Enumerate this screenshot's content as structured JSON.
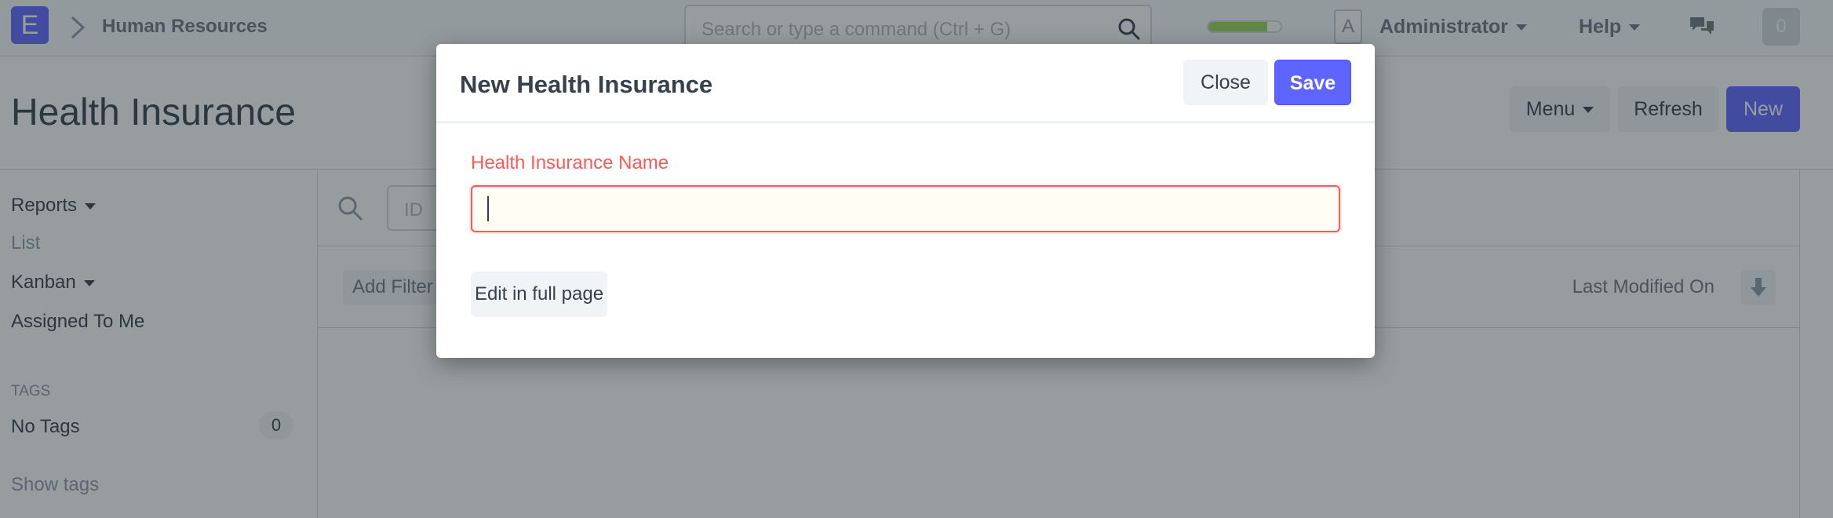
{
  "navbar": {
    "logo_letter": "E",
    "module": "Human Resources",
    "search_placeholder": "Search or type a command (Ctrl + G)",
    "progress": 0.82,
    "avatar_letter": "A",
    "user": "Administrator",
    "help": "Help",
    "notification_count": "0"
  },
  "page": {
    "title": "Health Insurance",
    "menu_label": "Menu",
    "refresh_label": "Refresh",
    "new_label": "New"
  },
  "sidebar": {
    "reports": "Reports",
    "list": "List",
    "kanban": "Kanban",
    "assigned": "Assigned To Me",
    "tags_heading": "TAGS",
    "no_tags": "No Tags",
    "tag_count": "0",
    "show_tags": "Show tags"
  },
  "list": {
    "id_placeholder": "ID",
    "add_filter": "Add Filter",
    "sort_label": "Last Modified On"
  },
  "modal": {
    "title": "New Health Insurance",
    "close_label": "Close",
    "save_label": "Save",
    "field_label": "Health Insurance Name",
    "field_value": "",
    "edit_full_label": "Edit in full page"
  },
  "colors": {
    "primary": "#5e64ff",
    "required": "#ff5858",
    "progress": "#98d85b"
  }
}
